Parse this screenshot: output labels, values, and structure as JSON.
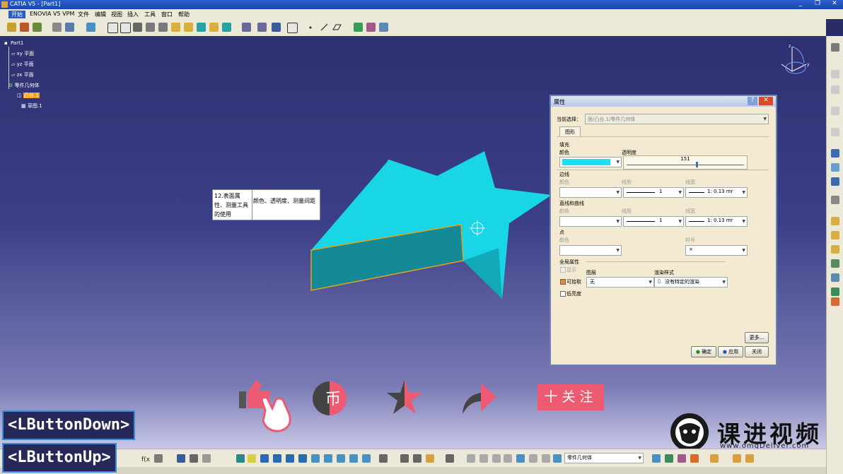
{
  "window": {
    "title": "CATIA V5 - [Part1]"
  },
  "menu": [
    "开始",
    "ENOVIA V5 VPM",
    "文件",
    "编辑",
    "视图",
    "插入",
    "工具",
    "窗口",
    "帮助"
  ],
  "tree": {
    "root": "Part1",
    "items": [
      "xy 平面",
      "yz 平面",
      "zx 平面",
      "零件几何体",
      "凸台.1",
      "草图.1"
    ]
  },
  "callout": {
    "left": "12.表面属性、测量工具的使用",
    "right": "颜色、透明度、测量间距"
  },
  "dialog": {
    "title": "属性",
    "current_selection_label": "当前选择：",
    "current_selection_value": "面/凸台.1/零件几何体",
    "tab": "图形",
    "fill_label": "填充",
    "fill_color_label": "颜色",
    "transparency_label": "透明度",
    "transparency_value": "151",
    "transparency_fraction": 0.59,
    "fill_color": "#19e0f2",
    "edge_label": "边线",
    "edge_color_label": "颜色",
    "edge_linetype_label": "线型",
    "edge_lineweight_label": "线宽",
    "edge_linetype_value": "1",
    "edge_lineweight_value": "1: 0.13 mr",
    "lines_label": "直线和曲线",
    "lines_color_label": "颜色",
    "lines_linetype_label": "线型",
    "lines_lineweight_label": "线宽",
    "lines_linetype_value": "1",
    "lines_lineweight_value": "1: 0.13 mr",
    "points_label": "点",
    "points_color_label": "颜色",
    "points_symbol_label": "符号",
    "points_symbol_value": "×",
    "global_label": "全局属性",
    "show_label": "显示",
    "layer_label": "图层",
    "layer_value": "无",
    "render_label": "渲染样式",
    "render_value": "没有特定的渲染",
    "pickable_label": "可拾取",
    "low_intensity_label": "低亮度",
    "more_button": "更多...",
    "ok_button": "确定",
    "apply_button": "应用",
    "close_button": "关闭"
  },
  "bottom_toolbar": {
    "dropdown_value": "零件几何体"
  },
  "overlay": {
    "lbutton_down": "<LButtonDown>",
    "lbutton_up": "<LButtonUp>",
    "follow": "十关注",
    "brand": "课进视频",
    "brand_url": "www.omgDeliver.com"
  },
  "colors": {
    "viewport_top": "#2e3071",
    "part_face": "#19d6e6",
    "part_side": "#138a96",
    "part_selected_edge": "#e8a21a"
  }
}
